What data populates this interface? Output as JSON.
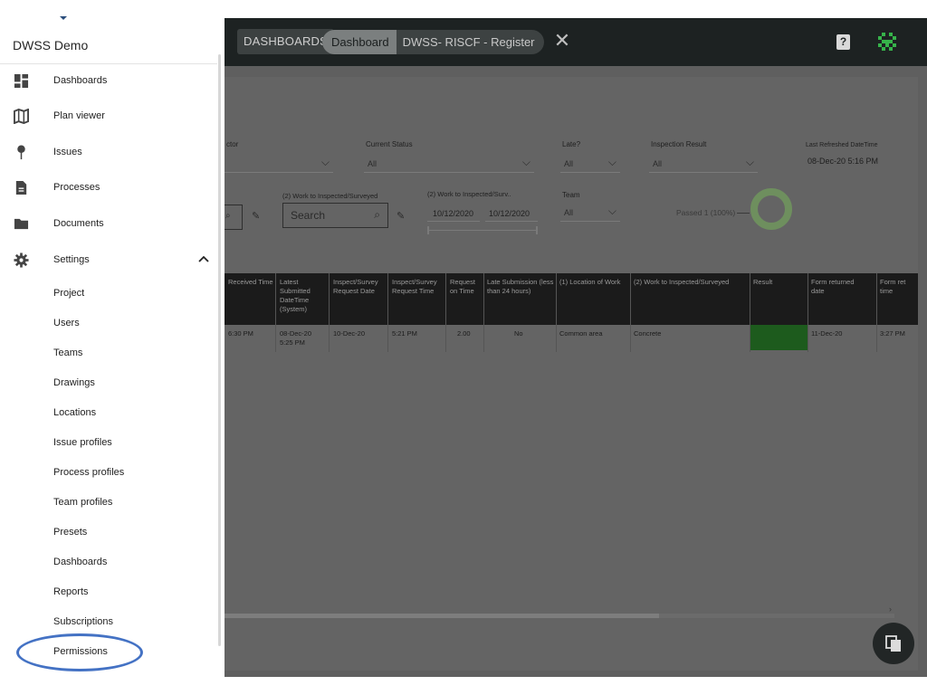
{
  "app": {
    "title": "DWSS Demo",
    "topbar": {
      "dashboards_chip": "DASHBOARDS",
      "breadcrumb_dashboard": "Dashboard",
      "breadcrumb_register": "DWSS- RISCF - Register",
      "close_icon": "close-icon",
      "help_icon": "help-icon",
      "avatar_icon": "avatar-icon",
      "help_glyph": "?"
    },
    "filters": {
      "contractor_label_partial": "ctor",
      "current_status_label": "Current Status",
      "current_status_value": "All",
      "late_label": "Late?",
      "late_value": "All",
      "inspection_result_label": "Inspection Result",
      "inspection_result_value": "All",
      "last_refreshed_label": "Last Refreshed DateTime",
      "last_refreshed_value": "08-Dec-20 5:16 PM",
      "work_label": "(2) Work to Inspected/Surveyed",
      "work_search_placeholder": "Search",
      "work_range_label": "(2) Work to Inspected/Surv..",
      "date_from": "10/12/2020",
      "date_to": "10/12/2020",
      "team_label": "Team",
      "team_value": "All",
      "passed_text": "Passed 1 (100%)"
    },
    "table": {
      "headers": [
        "Received Time",
        "Latest Submitted DateTime (System)",
        "Inspect/Survey Request Date",
        "Inspect/Survey Request Time",
        "Request on Time",
        "Late Submission (less than 24 hours)",
        "(1) Location of Work",
        "(2) Work to Inspected/Surveyed",
        "Result",
        "Form returned date",
        "Form ret time"
      ],
      "row": [
        "6:30 PM",
        "08-Dec-20 5:25 PM",
        "10-Dec-20",
        "5:21 PM",
        "2.00",
        "No",
        "Common area",
        "Concrete",
        "",
        "11-Dec-20",
        "3:27 PM"
      ],
      "result_color": "#1d5b1d"
    },
    "fab_icon": "copy-icon"
  },
  "drawer": {
    "title": "DWSS Demo",
    "items": [
      {
        "label": "Dashboards",
        "icon": "dashboard-icon"
      },
      {
        "label": "Plan viewer",
        "icon": "map-icon"
      },
      {
        "label": "Issues",
        "icon": "pin-icon"
      },
      {
        "label": "Processes",
        "icon": "document-icon"
      },
      {
        "label": "Documents",
        "icon": "folder-icon"
      },
      {
        "label": "Settings",
        "icon": "gear-icon"
      }
    ],
    "settings_children": [
      "Project",
      "Users",
      "Teams",
      "Drawings",
      "Locations",
      "Issue profiles",
      "Process profiles",
      "Team profiles",
      "Presets",
      "Dashboards",
      "Reports",
      "Subscriptions",
      "Permissions"
    ],
    "highlight_color": "#4472c4"
  }
}
